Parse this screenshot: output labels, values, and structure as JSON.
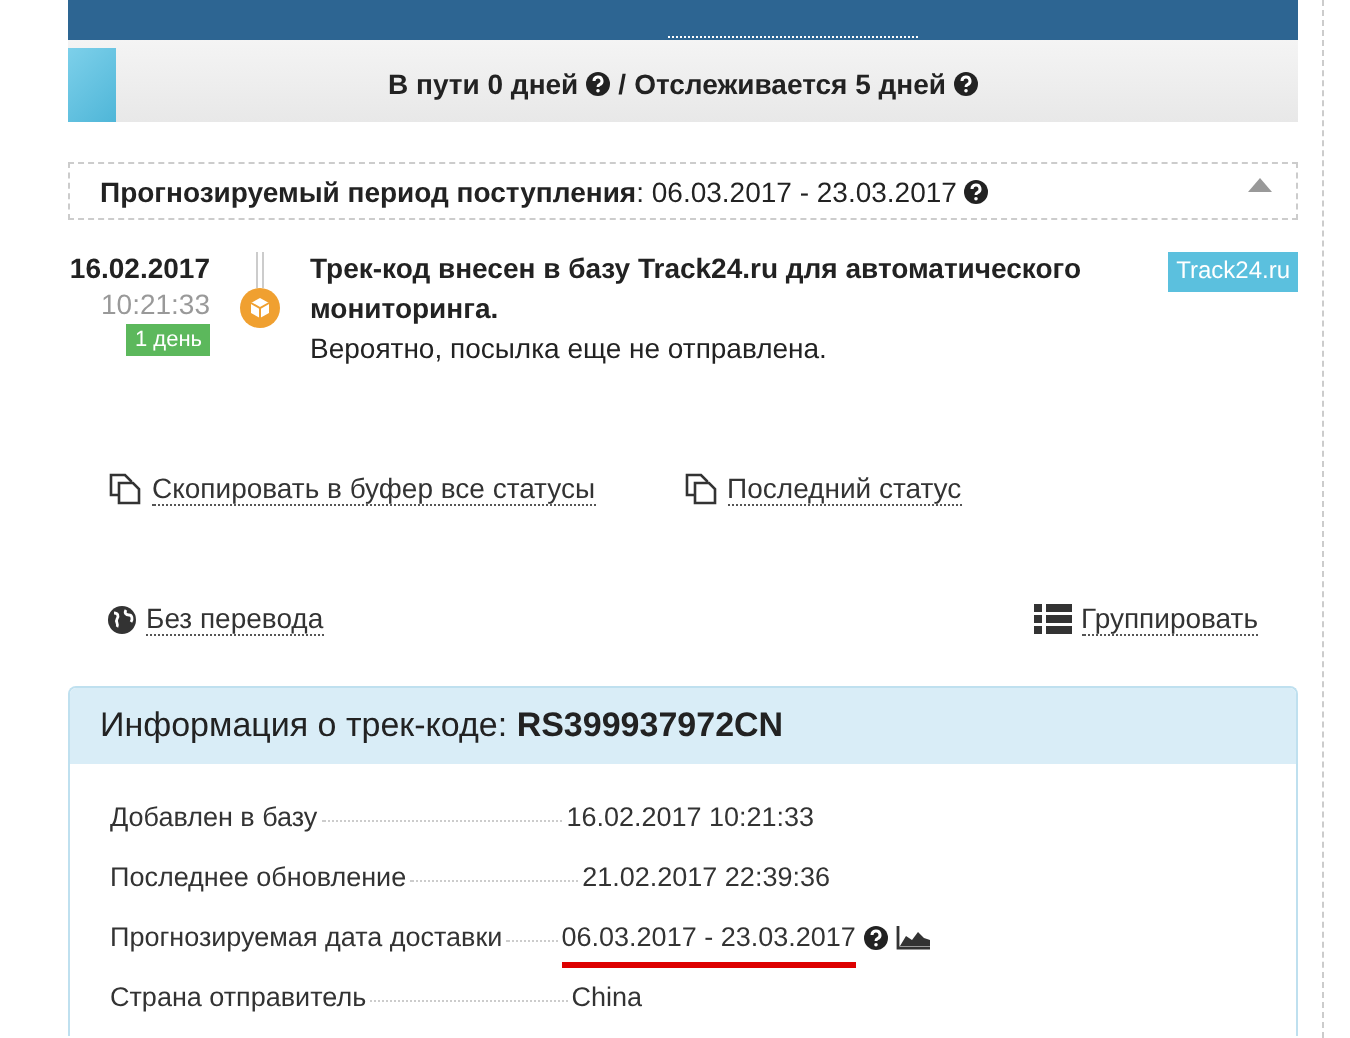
{
  "status_bar": {
    "in_transit": "В пути 0 дней",
    "separator": "/",
    "tracked": "Отслеживается 5 дней"
  },
  "forecast": {
    "label": "Прогнозируемый период поступления",
    "value": ": 06.03.2017 - 23.03.2017",
    "expanded": true
  },
  "events": [
    {
      "date": "16.02.2017",
      "time": "10:21:33",
      "badge": "1 день",
      "title": "Трек-код внесен в базу Track24.ru для автоматического мониторинга.",
      "note": "Вероятно, посылка еще не отправлена.",
      "source": "Track24.ru"
    }
  ],
  "actions": [
    {
      "label": "Скопировать в буфер все статусы"
    },
    {
      "label": "Последний статус"
    }
  ],
  "options": {
    "translate": "Без перевода",
    "group": "Группировать"
  },
  "info": {
    "title": "Информация о трек-коде: ",
    "code": "RS399937972CN",
    "rows": [
      {
        "label": "Добавлен в базу",
        "value": "16.02.2017 10:21:33",
        "highlighted": false,
        "extras": false
      },
      {
        "label": "Последнее обновление",
        "value": "21.02.2017 22:39:36",
        "highlighted": false,
        "extras": false
      },
      {
        "label": "Прогнозируемая дата доставки",
        "value": "06.03.2017 - 23.03.2017",
        "highlighted": true,
        "extras": true
      },
      {
        "label": "Страна отправитель",
        "value": "China",
        "highlighted": false,
        "extras": false
      }
    ]
  }
}
